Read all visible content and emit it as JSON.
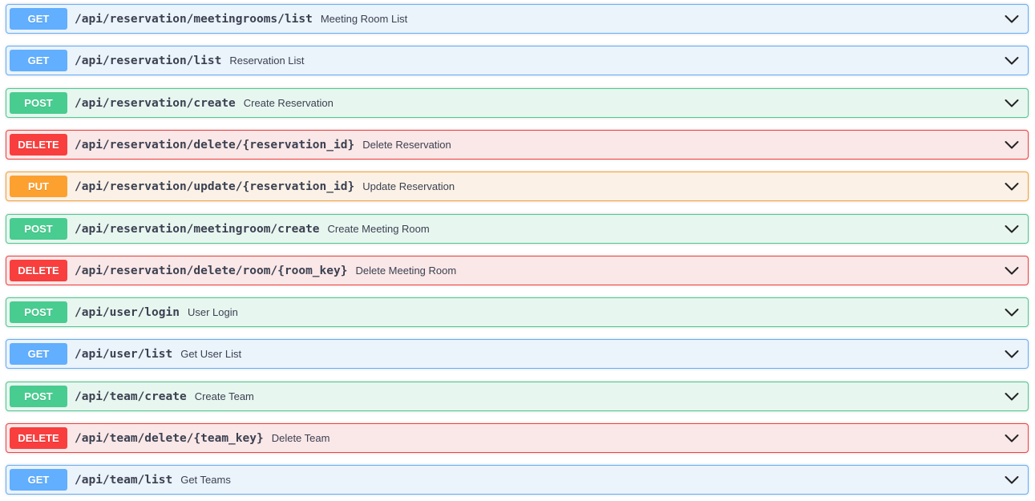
{
  "operations": [
    {
      "method": "GET",
      "path": "/api/reservation/meetingrooms/list",
      "summary": "Meeting Room List"
    },
    {
      "method": "GET",
      "path": "/api/reservation/list",
      "summary": "Reservation List"
    },
    {
      "method": "POST",
      "path": "/api/reservation/create",
      "summary": "Create Reservation"
    },
    {
      "method": "DELETE",
      "path": "/api/reservation/delete/{reservation_id}",
      "summary": "Delete Reservation"
    },
    {
      "method": "PUT",
      "path": "/api/reservation/update/{reservation_id}",
      "summary": "Update Reservation"
    },
    {
      "method": "POST",
      "path": "/api/reservation/meetingroom/create",
      "summary": "Create Meeting Room"
    },
    {
      "method": "DELETE",
      "path": "/api/reservation/delete/room/{room_key}",
      "summary": "Delete Meeting Room"
    },
    {
      "method": "POST",
      "path": "/api/user/login",
      "summary": "User Login"
    },
    {
      "method": "GET",
      "path": "/api/user/list",
      "summary": "Get User List"
    },
    {
      "method": "POST",
      "path": "/api/team/create",
      "summary": "Create Team"
    },
    {
      "method": "DELETE",
      "path": "/api/team/delete/{team_key}",
      "summary": "Delete Team"
    },
    {
      "method": "GET",
      "path": "/api/team/list",
      "summary": "Get Teams"
    }
  ],
  "icons": {
    "expand": "chevron-down-icon"
  },
  "colors": {
    "GET": "#61affe",
    "POST": "#49cc90",
    "DELETE": "#f93e3e",
    "PUT": "#fca130",
    "text": "#3b4151"
  }
}
